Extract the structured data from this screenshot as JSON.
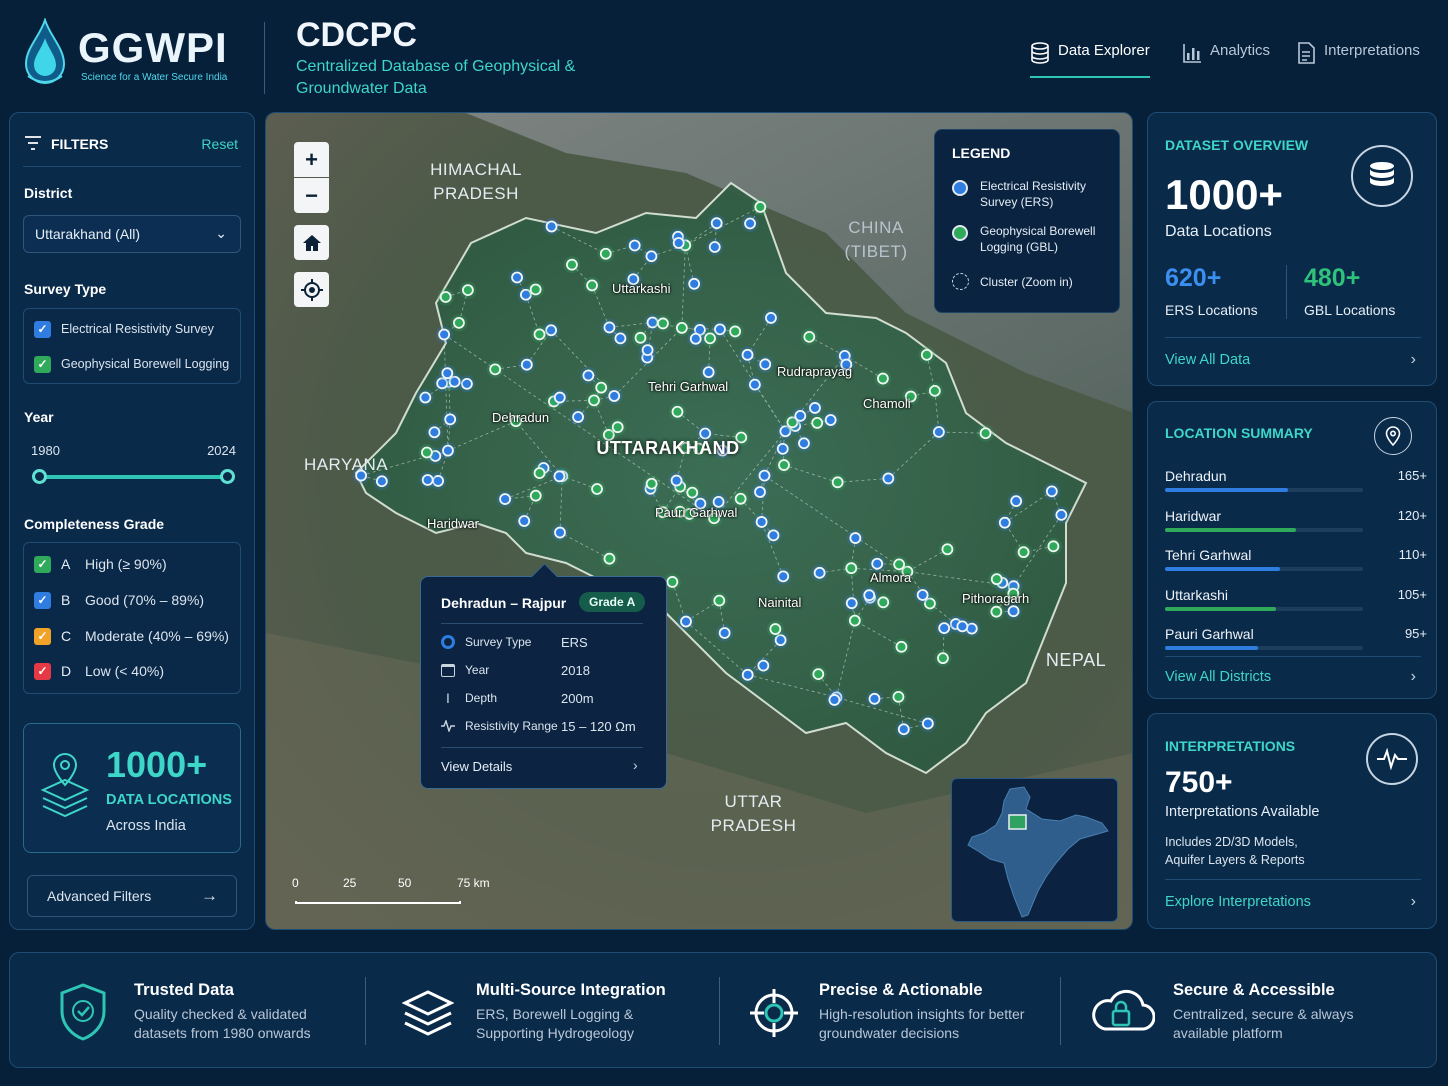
{
  "brand": {
    "name": "GGWPI",
    "tagline": "Science for a Water Secure India"
  },
  "app": {
    "title": "CDCPC",
    "subtitle": "Centralized Database of Geophysical & Groundwater Data"
  },
  "nav": [
    {
      "label": "Data Explorer",
      "icon": "database-icon",
      "active": true
    },
    {
      "label": "Analytics",
      "icon": "bar-chart-icon",
      "active": false
    },
    {
      "label": "Interpretations",
      "icon": "document-icon",
      "active": false
    }
  ],
  "filters": {
    "title": "FILTERS",
    "reset": "Reset",
    "district_label": "District",
    "district_value": "Uttarakhand (All)",
    "survey_label": "Survey Type",
    "survey_options": [
      {
        "label": "Electrical Resistivity Survey",
        "checked": true,
        "color": "#2f7de1"
      },
      {
        "label": "Geophysical Borewell Logging",
        "checked": true,
        "color": "#2eaa5a"
      }
    ],
    "year_label": "Year",
    "year_min": "1980",
    "year_max": "2024",
    "grade_label": "Completeness Grade",
    "grades": [
      {
        "letter": "A",
        "label": "High (≥ 90%)",
        "color": "#2eaa5a"
      },
      {
        "letter": "B",
        "label": "Good (70% – 89%)",
        "color": "#2f7de1"
      },
      {
        "letter": "C",
        "label": "Moderate (40% – 69%)",
        "color": "#f0a328"
      },
      {
        "letter": "D",
        "label": "Low  (< 40%)",
        "color": "#e53945"
      }
    ],
    "card": {
      "value": "1000+",
      "label": "DATA LOCATIONS",
      "sub": "Across India"
    },
    "advanced": "Advanced Filters"
  },
  "map": {
    "regions": {
      "himachal": "HIMACHAL\nPRADESH",
      "china": "CHINA\n(TIBET)",
      "haryana": "HARYANA",
      "uttarakhand": "UTTARAKHAND",
      "nepal": "NEPAL",
      "up": "UTTAR\nPRADESH"
    },
    "cities": [
      "Uttarkashi",
      "Tehri Garhwal",
      "Rudraprayag",
      "Chamoli",
      "Dehradun",
      "Haridwar",
      "Pauri Garhwal",
      "Almora",
      "Nainital",
      "Pithoragarh"
    ],
    "legend": {
      "title": "LEGEND",
      "items": [
        {
          "label": "Electrical Resistivity Survey (ERS)",
          "color": "#2f7de1"
        },
        {
          "label": "Geophysical Borewell Logging (GBL)",
          "color": "#2eaa5a"
        },
        {
          "label": "Cluster (Zoom in)",
          "color": "#c8d4e0"
        }
      ]
    },
    "tooltip": {
      "title": "Dehradun – Rajpur",
      "grade": "Grade A",
      "rows": [
        {
          "key": "Survey Type",
          "value": "ERS"
        },
        {
          "key": "Year",
          "value": "2018"
        },
        {
          "key": "Depth",
          "value": "200m"
        },
        {
          "key": "Resistivity Range",
          "value": "15 – 120 Ωm"
        }
      ],
      "link": "View Details"
    },
    "scale": [
      "0",
      "25",
      "50",
      "75 km"
    ]
  },
  "overview": {
    "title": "DATASET OVERVIEW",
    "total": "1000+",
    "total_label": "Data Locations",
    "ers": "620+",
    "ers_label": "ERS Locations",
    "gbl": "480+",
    "gbl_label": "GBL Locations",
    "link": "View All Data"
  },
  "location_summary": {
    "title": "LOCATION SUMMARY",
    "districts": [
      {
        "name": "Dehradun",
        "count": "165+",
        "fraction": 0.62,
        "color": "#2f7de1"
      },
      {
        "name": "Haridwar",
        "count": "120+",
        "fraction": 0.66,
        "color": "#2eaa5a"
      },
      {
        "name": "Tehri Garhwal",
        "count": "110+",
        "fraction": 0.58,
        "color": "#2f7de1"
      },
      {
        "name": "Uttarkashi",
        "count": "105+",
        "fraction": 0.56,
        "color": "#2eaa5a"
      },
      {
        "name": "Pauri Garhwal",
        "count": "95+",
        "fraction": 0.47,
        "color": "#2f7de1"
      }
    ],
    "link": "View All Districts"
  },
  "interpretations": {
    "title": "INTERPRETATIONS",
    "value": "750+",
    "label": "Interpretations Available",
    "note": "Includes 2D/3D Models, Aquifer Layers & Reports",
    "link": "Explore Interpretations"
  },
  "features": [
    {
      "title": "Trusted Data",
      "desc": "Quality checked & validated datasets from 1980 onwards",
      "icon": "shield-check-icon"
    },
    {
      "title": "Multi-Source Integration",
      "desc": "ERS, Borewell Logging & Supporting Hydrogeology",
      "icon": "layers-icon"
    },
    {
      "title": "Precise & Actionable",
      "desc": "High-resolution insights for better groundwater decisions",
      "icon": "crosshair-icon"
    },
    {
      "title": "Secure & Accessible",
      "desc": "Centralized, secure & always available platform",
      "icon": "cloud-lock-icon"
    }
  ]
}
